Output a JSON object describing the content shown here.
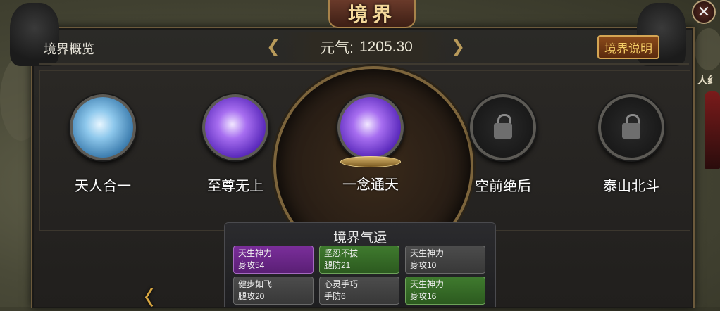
{
  "window": {
    "title": "境界",
    "close_glyph": "✕",
    "side_label": "人纟"
  },
  "header": {
    "tab_title": "境界概览",
    "energy_label": "元气:",
    "energy_value": "1205.30",
    "help_button": "境界说明",
    "prev_arrow": "❮",
    "next_arrow": "❯"
  },
  "realms": [
    {
      "name": "天人合一",
      "orb": "blue-orb",
      "state": "unlocked"
    },
    {
      "name": "至尊无上",
      "orb": "purple-orb",
      "state": "unlocked"
    },
    {
      "name": "一念通天",
      "orb": "purple-orb",
      "state": "current"
    },
    {
      "name": "空前绝后",
      "orb": "lock-icon",
      "state": "locked"
    },
    {
      "name": "泰山北斗",
      "orb": "lock-icon",
      "state": "locked"
    }
  ],
  "luck": {
    "title": "境界气运",
    "buffs": [
      {
        "name": "天生神力",
        "stat": "身攻54",
        "color": "purple"
      },
      {
        "name": "坚忍不拔",
        "stat": "腿防21",
        "color": "green"
      },
      {
        "name": "天生神力",
        "stat": "身攻10",
        "color": "gray"
      },
      {
        "name": "健步如飞",
        "stat": "腿攻20",
        "color": "gray"
      },
      {
        "name": "心灵手巧",
        "stat": "手防6",
        "color": "gray"
      },
      {
        "name": "天生神力",
        "stat": "身攻16",
        "color": "green"
      }
    ]
  },
  "nav": {
    "left_arrow": "〈"
  },
  "colors": {
    "accent_gold": "#d4a553",
    "panel_bg": "#2b2a27",
    "purple_buff": "#7a2e9a",
    "green_buff": "#3f7a2e"
  }
}
